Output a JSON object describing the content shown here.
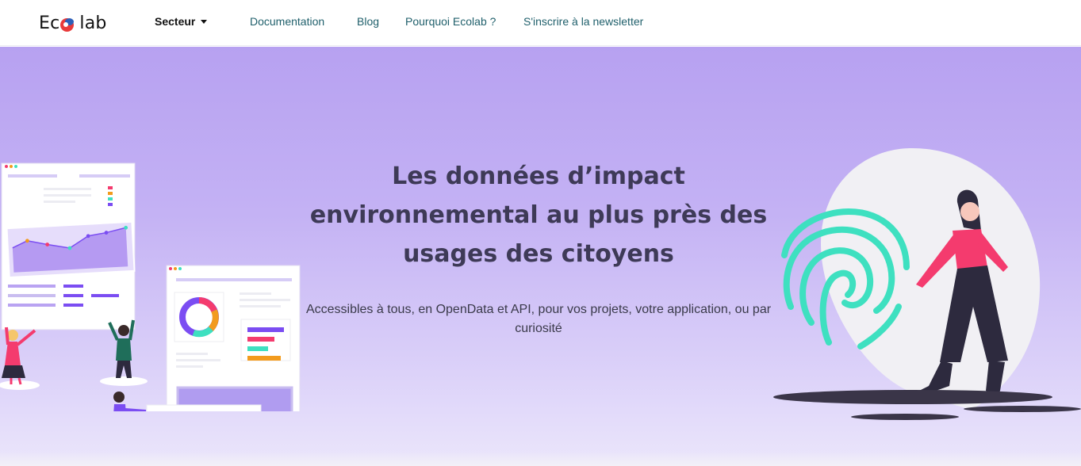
{
  "navbar": {
    "logo": {
      "text_before": "Ec",
      "text_after": "lab",
      "icon": "globe-logo-icon"
    },
    "links": {
      "sector": "Secteur",
      "documentation": "Documentation",
      "blog": "Blog",
      "why": "Pourquoi Ecolab ?",
      "newsletter": "S'inscrire à la newsletter"
    }
  },
  "hero": {
    "title": "Les données d’impact environnemental au plus près des usages des citoyens",
    "subtitle": "Accessibles à tous, en OpenData et API, pour vos projets, votre application, ou par curiosité",
    "illustrations": {
      "left": "dashboard-team-illustration",
      "right": "fingerprint-woman-illustration"
    }
  },
  "colors": {
    "nav_link": "#1f5f6b",
    "title": "#3e3a57",
    "hero_gradient_top": "#b7a1f1",
    "hero_gradient_bottom": "#ebe6fb",
    "accent_purple": "#7b4df2",
    "accent_pink": "#f43b6e",
    "accent_teal": "#3ee0c0",
    "accent_orange": "#f29b1d"
  }
}
